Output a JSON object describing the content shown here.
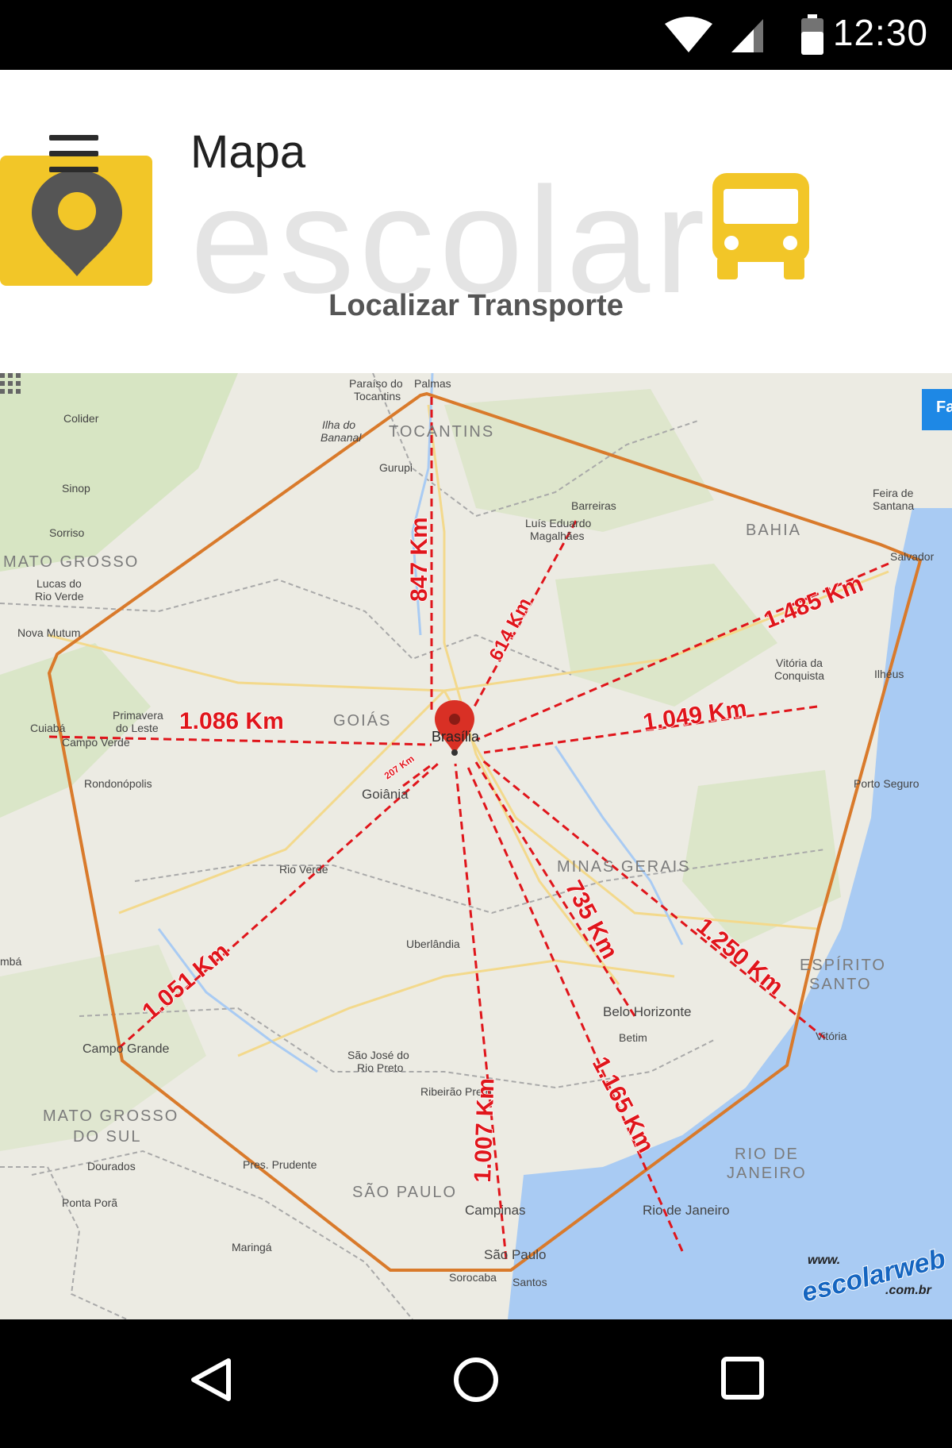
{
  "status_bar": {
    "time": "12:30",
    "icons": [
      "wifi-icon",
      "signal-icon",
      "battery-icon"
    ]
  },
  "header": {
    "title": "Mapa",
    "banner_watermark": "escolar",
    "subtitle": "Localizar Transporte",
    "menu_icon": "hamburger-menu-icon",
    "logo_icon": "location-pin-icon",
    "bus_icon": "bus-icon",
    "colors": {
      "logo_yellow": "#f2c628",
      "pin_gray": "#555555"
    }
  },
  "map": {
    "regions": [
      "TOCANTINS",
      "BAHIA",
      "MATO GROSSO",
      "GOIÁS",
      "MINAS GERAIS",
      "ESPÍRITO",
      "SANTO",
      "MATO GROSSO",
      "DO SUL",
      "SÃO PAULO",
      "RIO DE",
      "JANEIRO"
    ],
    "cities": [
      "Paraíso do",
      "Tocantins",
      "Palmas",
      "Colider",
      "Ilha do",
      "Bananal",
      "Gurupi",
      "Sinop",
      "Sorriso",
      "Barreiras",
      "Luís Eduardo",
      "Magalhães",
      "Feira de",
      "Santana",
      "Salvador",
      "Lucas do",
      "Rio Verde",
      "Nova Mutum",
      "Vitória da",
      "Conquista",
      "Ilhéus",
      "Cuiabá",
      "Primavera",
      "do Leste",
      "Campo Verde",
      "Brasília",
      "Goiânia",
      "Rondonópolis",
      "Porto Seguro",
      "Rio Verde",
      "Uberlândia",
      "mbá",
      "Belo Horizonte",
      "Betim",
      "Vitória",
      "Campo Grande",
      "São José do",
      "Rio Preto",
      "Ribeirão Preto",
      "Dourados",
      "Pres. Prudente",
      "Ponta Porã",
      "Campinas",
      "Rio de Janeiro",
      "Maringá",
      "São Paulo",
      "Sorocaba",
      "Santos"
    ],
    "distances": [
      "847 Km",
      "614 Km",
      "1.485 Km",
      "1.086 Km",
      "1.049 Km",
      "207 Km",
      "1.051 Km",
      "735 Km",
      "1.250 Km",
      "1.007 Km",
      "1.165 Km"
    ],
    "watermark": {
      "www": "www.",
      "brand": "escolarweb",
      "domain": ".com.br"
    },
    "tab_label": "Fa",
    "apps_icon": "apps-grid-icon",
    "marker_icon": "map-marker-icon",
    "colors": {
      "distance_red": "#e0151b",
      "route_orange": "#d97a2b",
      "land": "#ecebe3",
      "sea": "#a9cbf3",
      "park": "#cfe2b5"
    }
  },
  "nav_bar": {
    "buttons": [
      "back-icon",
      "home-icon",
      "recents-icon"
    ]
  }
}
